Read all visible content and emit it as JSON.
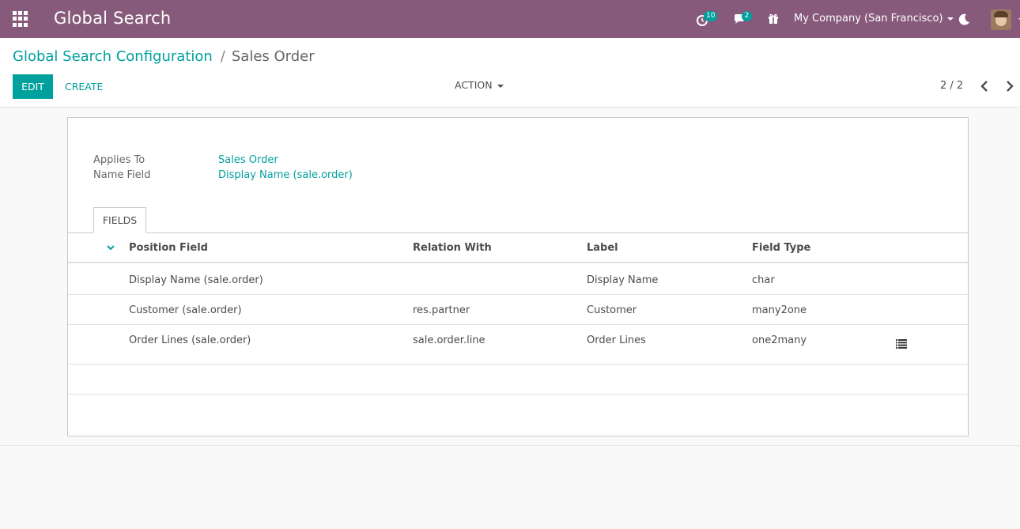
{
  "navbar": {
    "app_title": "Global Search",
    "activity_count": "10",
    "message_count": "2",
    "company": "My Company (San Francisco)",
    "accent_color": "#875a7b"
  },
  "breadcrumb": {
    "parent": "Global Search Configuration",
    "separator": "/",
    "current": "Sales Order"
  },
  "toolbar": {
    "edit_label": "EDIT",
    "create_label": "CREATE",
    "action_label": "ACTION",
    "pager": "2 / 2"
  },
  "form": {
    "applies_to_label": "Applies To",
    "applies_to_value": "Sales Order",
    "name_field_label": "Name Field",
    "name_field_value": "Display Name (sale.order)",
    "tab_label": "FIELDS"
  },
  "table": {
    "headers": [
      "Position Field",
      "Relation With",
      "Label",
      "Field Type"
    ],
    "rows": [
      {
        "position_field": "Display Name (sale.order)",
        "relation_with": "",
        "label": "Display Name",
        "field_type": "char"
      },
      {
        "position_field": "Customer (sale.order)",
        "relation_with": "res.partner",
        "label": "Customer",
        "field_type": "many2one"
      },
      {
        "position_field": "Order Lines (sale.order)",
        "relation_with": "sale.order.line",
        "label": "Order Lines",
        "field_type": "one2many"
      }
    ]
  },
  "colors": {
    "primary": "#00a09d",
    "navbar": "#875a7b"
  }
}
